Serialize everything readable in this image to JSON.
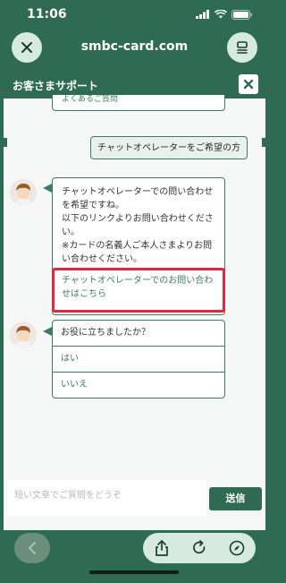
{
  "status": {
    "time": "11:06"
  },
  "browser": {
    "url": "smbc-card.com"
  },
  "chat": {
    "title": "お客さまサポート",
    "top_option": "よくあるご質問",
    "user_message": "チャットオペレーターをご希望の方",
    "operator_message": "チャットオペレーターでの問い合わせを希望ですね。\n以下のリンクよりお問い合わせください。\n※カードの名義人ご本人さまよりお問い合わせください。",
    "operator_link": "チャットオペレーターでのお問い合わせはこちら",
    "question": "お役に立ちましたか？",
    "options": [
      "はい",
      "いいえ"
    ],
    "input_placeholder": "短い文章でご質問をどうぞ",
    "send_label": "送信"
  },
  "colors": {
    "brand": "#2f6b52",
    "highlight": "#e0293f"
  }
}
